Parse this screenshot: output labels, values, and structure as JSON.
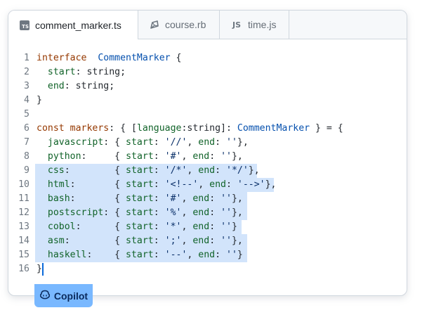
{
  "tabs": [
    {
      "label": "comment_marker.ts",
      "icon": "typescript-file-icon",
      "icon_text": "TS",
      "active": true
    },
    {
      "label": "course.rb",
      "icon": "ruby-file-icon",
      "active": false
    },
    {
      "label": "time.js",
      "icon": "javascript-file-icon",
      "icon_text": "JS",
      "active": false
    }
  ],
  "code_lines": [
    {
      "n": "1"
    },
    {
      "n": "2"
    },
    {
      "n": "3"
    },
    {
      "n": "4"
    },
    {
      "n": "5"
    },
    {
      "n": "6"
    },
    {
      "n": "7"
    },
    {
      "n": "8"
    },
    {
      "n": "9"
    },
    {
      "n": "10"
    },
    {
      "n": "11"
    },
    {
      "n": "12"
    },
    {
      "n": "13"
    },
    {
      "n": "14"
    },
    {
      "n": "15"
    },
    {
      "n": "16"
    }
  ],
  "code_text": [
    [
      [
        "kw",
        "interface"
      ],
      [
        "",
        "  "
      ],
      [
        "type",
        "CommentMarker"
      ],
      [
        "",
        " {"
      ]
    ],
    [
      [
        "",
        ""
      ],
      [
        "prop",
        "  start"
      ],
      [
        "",
        ": string;"
      ]
    ],
    [
      [
        "",
        ""
      ],
      [
        "prop",
        "  end"
      ],
      [
        "",
        ": string;"
      ]
    ],
    [
      [
        "",
        "}"
      ]
    ],
    [
      [
        "",
        ""
      ]
    ],
    [
      [
        "kw",
        "const"
      ],
      [
        "",
        " "
      ],
      [
        "kw",
        "markers"
      ],
      [
        "",
        ": { ["
      ],
      [
        "prop",
        "language"
      ],
      [
        "",
        ":string]: "
      ],
      [
        "type",
        "CommentMarker"
      ],
      [
        "",
        " } = {"
      ]
    ],
    [
      [
        "prop",
        "  javascript"
      ],
      [
        "",
        ": { "
      ],
      [
        "prop",
        "start"
      ],
      [
        "",
        ": "
      ],
      [
        "str",
        "'//'"
      ],
      [
        "",
        ", "
      ],
      [
        "prop",
        "end"
      ],
      [
        "",
        ": "
      ],
      [
        "str",
        "''"
      ],
      [
        "",
        "},"
      ]
    ],
    [
      [
        "prop",
        "  python"
      ],
      [
        "",
        ":     { "
      ],
      [
        "prop",
        "start"
      ],
      [
        "",
        ": "
      ],
      [
        "str",
        "'#'"
      ],
      [
        "",
        ", "
      ],
      [
        "prop",
        "end"
      ],
      [
        "",
        ": "
      ],
      [
        "str",
        "''"
      ],
      [
        "",
        "},"
      ]
    ],
    [
      [
        "prop",
        "  css"
      ],
      [
        "",
        ":        { "
      ],
      [
        "prop",
        "start"
      ],
      [
        "",
        ": "
      ],
      [
        "str",
        "'/*'"
      ],
      [
        "",
        ", "
      ],
      [
        "prop",
        "end"
      ],
      [
        "",
        ": "
      ],
      [
        "str",
        "'*/'"
      ],
      [
        "",
        "},"
      ]
    ],
    [
      [
        "prop",
        "  html"
      ],
      [
        "",
        ":       { "
      ],
      [
        "prop",
        "start"
      ],
      [
        "",
        ": "
      ],
      [
        "str",
        "'<!--'"
      ],
      [
        "",
        ", "
      ],
      [
        "prop",
        "end"
      ],
      [
        "",
        ": "
      ],
      [
        "str",
        "'-->'"
      ],
      [
        "",
        "},"
      ]
    ],
    [
      [
        "prop",
        "  bash"
      ],
      [
        "",
        ":       { "
      ],
      [
        "prop",
        "start"
      ],
      [
        "",
        ": "
      ],
      [
        "str",
        "'#'"
      ],
      [
        "",
        ", "
      ],
      [
        "prop",
        "end"
      ],
      [
        "",
        ": "
      ],
      [
        "str",
        "''"
      ],
      [
        "",
        "},"
      ]
    ],
    [
      [
        "prop",
        "  postscript"
      ],
      [
        "",
        ": { "
      ],
      [
        "prop",
        "start"
      ],
      [
        "",
        ": "
      ],
      [
        "str",
        "'%'"
      ],
      [
        "",
        ", "
      ],
      [
        "prop",
        "end"
      ],
      [
        "",
        ": "
      ],
      [
        "str",
        "''"
      ],
      [
        "",
        "},"
      ]
    ],
    [
      [
        "prop",
        "  cobol"
      ],
      [
        "",
        ":      { "
      ],
      [
        "prop",
        "start"
      ],
      [
        "",
        ": "
      ],
      [
        "str",
        "'*'"
      ],
      [
        "",
        ", "
      ],
      [
        "prop",
        "end"
      ],
      [
        "",
        ": "
      ],
      [
        "str",
        "''"
      ],
      [
        "",
        "}"
      ]
    ],
    [
      [
        "prop",
        "  asm"
      ],
      [
        "",
        ":        { "
      ],
      [
        "prop",
        "start"
      ],
      [
        "",
        ": "
      ],
      [
        "str",
        "';'"
      ],
      [
        "",
        ", "
      ],
      [
        "prop",
        "end"
      ],
      [
        "",
        ": "
      ],
      [
        "str",
        "''"
      ],
      [
        "",
        "},"
      ]
    ],
    [
      [
        "prop",
        "  haskell"
      ],
      [
        "",
        ":    { "
      ],
      [
        "prop",
        "start"
      ],
      [
        "",
        ": "
      ],
      [
        "str",
        "'--'"
      ],
      [
        "",
        ", "
      ],
      [
        "prop",
        "end"
      ],
      [
        "",
        ": "
      ],
      [
        "str",
        "''"
      ],
      [
        "",
        "}"
      ]
    ],
    [
      [
        "",
        "}"
      ]
    ]
  ],
  "selected_lines": [
    9,
    10,
    11,
    12,
    13,
    14,
    15
  ],
  "cursor_line": 16,
  "copilot": {
    "label": "Copilot",
    "icon": "copilot-icon"
  },
  "colors": {
    "selection": "#d2e4fb",
    "keyword": "#953800",
    "type": "#0550ae",
    "property": "#116329",
    "string": "#0a3069",
    "copilot_badge": "#79b8ff"
  }
}
